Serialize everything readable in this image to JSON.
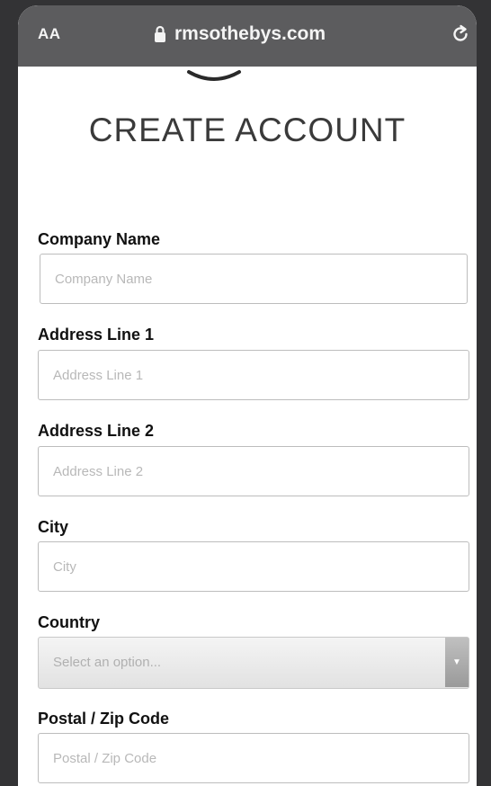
{
  "browser": {
    "text_size_label": "AA",
    "domain": "rmsothebys.com"
  },
  "page": {
    "title": "CREATE ACCOUNT"
  },
  "form": {
    "company_name": {
      "label": "Company Name",
      "placeholder": "Company Name",
      "value": ""
    },
    "address_line_1": {
      "label": "Address Line 1",
      "placeholder": "Address Line 1",
      "value": ""
    },
    "address_line_2": {
      "label": "Address Line 2",
      "placeholder": "Address Line 2",
      "value": ""
    },
    "city": {
      "label": "City",
      "placeholder": "City",
      "value": ""
    },
    "country": {
      "label": "Country",
      "selected": "Select an option..."
    },
    "postal_code": {
      "label": "Postal / Zip Code",
      "placeholder": "Postal / Zip Code",
      "value": ""
    }
  },
  "colors": {
    "url_bar": "#5c5c5e",
    "background": "#333335",
    "page": "#ffffff",
    "input_border": "#bdbdbd"
  },
  "icons": {
    "lock": "lock-icon",
    "reload": "reload-icon",
    "dropdown": "chevron-down-icon"
  }
}
